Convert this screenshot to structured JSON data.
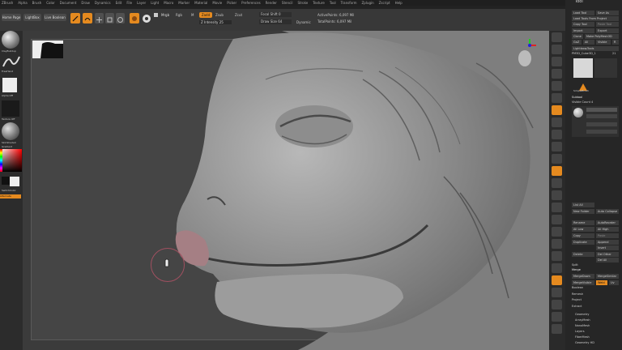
{
  "menu": [
    "ZBrush",
    "Alpha",
    "Brush",
    "Color",
    "Document",
    "Draw",
    "Dynamics",
    "Edit",
    "File",
    "Layer",
    "Light",
    "Macro",
    "Marker",
    "Material",
    "Movie",
    "Picker",
    "Preferences",
    "Render",
    "Stencil",
    "Stroke",
    "Texture",
    "Tool",
    "Transform",
    "Zplugin",
    "Zscript",
    "Help"
  ],
  "toolbar": {
    "home_page": "Home Page",
    "lightbox": "LightBox",
    "live_boolean": "Live Boolean",
    "mrgb": "Mrgb",
    "rgb": "Rgb",
    "m": "M",
    "zadd": "Zadd",
    "zsub": "Zsub",
    "zcut": "Zcut",
    "focal_shift": "Focal Shift 0",
    "draw_size": "Draw Size 64",
    "dynamic": "Dynamic",
    "z_intensity": "Z Intensity 25",
    "active_points": "ActivePoints: 6,097 Mil",
    "total_points": "TotalPoints: 6,097 Mil"
  },
  "left_shelf": {
    "brush_label": "ClayBuildup",
    "stroke_label": "FreeHand",
    "alpha_label": "Alpha Off",
    "texture_label": "Texture Off",
    "material_label": "SkinShade4",
    "gradient_label": "Gradient",
    "switch_color": "SwitchColor",
    "alternate": "Alternate"
  },
  "tool_panel": {
    "title": "Tool",
    "load_tool": "Load Tool",
    "save_as": "Save As",
    "load_tools_from_project": "Load Tools From Project",
    "copy_tool": "Copy Tool",
    "paste_tool": "Paste Tool",
    "import": "Import",
    "export": "Export",
    "clone": "Clone",
    "make_polymesh": "Make PolyMesh3D",
    "goz": "GoZ",
    "all": "All",
    "visible": "Visible",
    "r": "R",
    "lightbox_tools": "Lightbox▸Tools",
    "current_tool": "PM3D_Cube3D_1",
    "tool_count": "21",
    "simple_brush": "SimpleBrush",
    "subtool": "Subtool",
    "visible_count": "Visible Count 4",
    "list_all": "List All",
    "auto_collapse": "Auto Collapse",
    "new_folder": "New Folder",
    "rename": "Rename",
    "auto_reorder": "AutoReorder",
    "all_low": "All Low",
    "all_high": "All High",
    "copy": "Copy",
    "paste": "Paste",
    "duplicate": "Duplicate",
    "append": "Append",
    "insert": "Insert",
    "delete": "Delete",
    "del_other": "Del Other",
    "del_all": "Del All",
    "split": "Split",
    "merge": "Merge",
    "merge_down": "MergeDown",
    "merge_similar": "MergeSimilar",
    "merge_visible": "MergeVisible",
    "weld": "Weld",
    "uv": "Uv",
    "boolean": "Boolean",
    "remesh": "Remesh",
    "project": "Project",
    "extract": "Extract",
    "sections": [
      "Geometry",
      "ArrayMesh",
      "NanoMesh",
      "Layers",
      "FiberMesh",
      "Geometry HD"
    ]
  },
  "colors": {
    "accent": "#e58a1f",
    "panel_bg": "#262626",
    "canvas_bg": "#454545"
  }
}
